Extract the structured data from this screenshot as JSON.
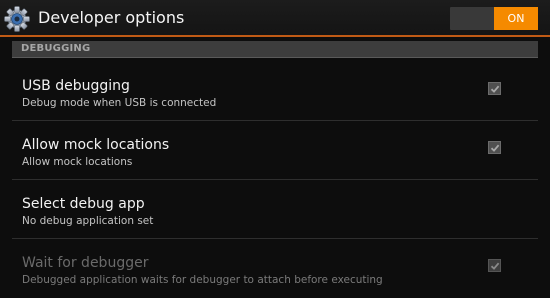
{
  "header": {
    "title": "Developer options",
    "toggle_label": "ON",
    "accent_color": "#f58a00"
  },
  "icons": {
    "app_icon": "gear-icon",
    "check": "checkmark-icon"
  },
  "section": {
    "title": "DEBUGGING"
  },
  "items": [
    {
      "label": "USB debugging",
      "description": "Debug mode when USB is connected",
      "checked": true,
      "enabled": true
    },
    {
      "label": "Allow mock locations",
      "description": "Allow mock locations",
      "checked": true,
      "enabled": true
    },
    {
      "label": "Select debug app",
      "description": "No debug application set",
      "enabled": true
    },
    {
      "label": "Wait for debugger",
      "description": "Debugged application waits for debugger to attach before executing",
      "checked": true,
      "enabled": false
    }
  ]
}
